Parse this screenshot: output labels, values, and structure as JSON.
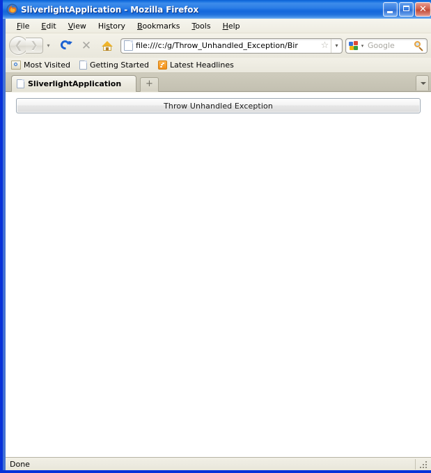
{
  "window": {
    "title": "SliverlightApplication - Mozilla Firefox",
    "app_icon": "firefox-logo-icon",
    "controls": {
      "minimize": "minimize-button",
      "maximize": "maximize-button",
      "close": "close-button"
    }
  },
  "menubar": {
    "items": [
      {
        "label": "File",
        "accesskey": "F"
      },
      {
        "label": "Edit",
        "accesskey": "E"
      },
      {
        "label": "View",
        "accesskey": "V"
      },
      {
        "label": "History",
        "accesskey": "s"
      },
      {
        "label": "Bookmarks",
        "accesskey": "B"
      },
      {
        "label": "Tools",
        "accesskey": "T"
      },
      {
        "label": "Help",
        "accesskey": "H"
      }
    ]
  },
  "navbar": {
    "back_button": "Back",
    "forward_button": "Forward",
    "reload_button": "Reload",
    "stop_button": "Stop",
    "home_button": "Home",
    "address": {
      "value": "file:///c:/g/Throw_Unhandled_Exception/Bir",
      "placeholder": "",
      "favicon": "generic-page-icon",
      "bookmark_star": "☆",
      "dropdown": "▾"
    },
    "search": {
      "engine": "Google",
      "engine_icon": "google-favicon",
      "placeholder": "Google",
      "value": "",
      "dropdown": "▾",
      "go_icon": "magnifier-icon"
    }
  },
  "bookmarks_bar": {
    "items": [
      {
        "label": "Most Visited",
        "icon": "most-visited-icon"
      },
      {
        "label": "Getting Started",
        "icon": "page-icon"
      },
      {
        "label": "Latest Headlines",
        "icon": "rss-feed-icon"
      }
    ]
  },
  "tabstrip": {
    "tabs": [
      {
        "label": "SliverlightApplication",
        "icon": "page-icon",
        "active": true
      }
    ],
    "new_tab_label": "+",
    "tab_list_button": "▾"
  },
  "content": {
    "button": {
      "label": "Throw Unhandled Exception"
    }
  },
  "statusbar": {
    "text": "Done",
    "resize_grip": "resize-grip"
  },
  "colors": {
    "titlebar_blue": "#1b74e2",
    "frame_blue": "#0831d9",
    "chrome_beige": "#f2f0e6",
    "tabstrip_grey": "#c3c0b1",
    "content_white": "#ffffff",
    "close_red": "#c14a35"
  }
}
